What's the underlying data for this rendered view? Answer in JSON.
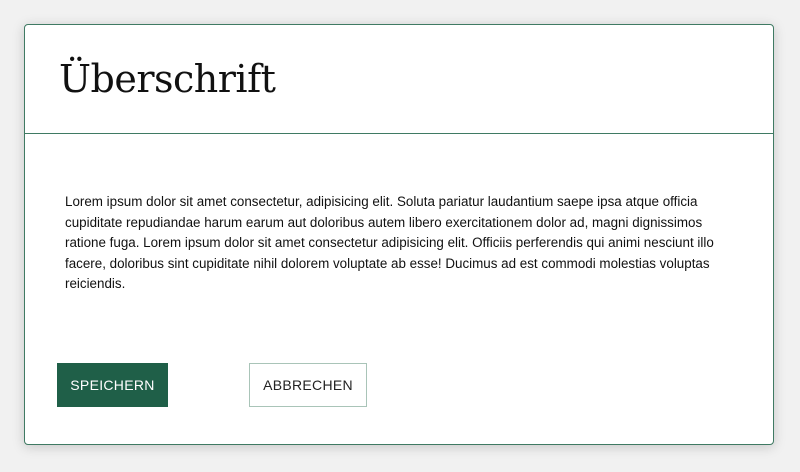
{
  "dialog": {
    "title": "Überschrift",
    "body": "Lorem ipsum dolor sit amet consectetur, adipisicing elit. Soluta pariatur laudantium saepe ipsa atque officia cupiditate repudiandae harum earum aut doloribus autem libero exercitationem dolor ad, magni dignissimos ratione fuga. Lorem ipsum dolor sit amet consectetur adipisicing elit. Officiis perferendis qui animi nesciunt illo facere, doloribus sint cupiditate nihil dolorem voluptate ab esse! Ducimus ad est commodi molestias voluptas reiciendis.",
    "buttons": {
      "save_label": "SPEICHERN",
      "cancel_label": "ABBRECHEN"
    }
  },
  "colors": {
    "accent": "#1f5f48",
    "border": "#3f7a63",
    "secondary_border": "#a9c4b8"
  }
}
